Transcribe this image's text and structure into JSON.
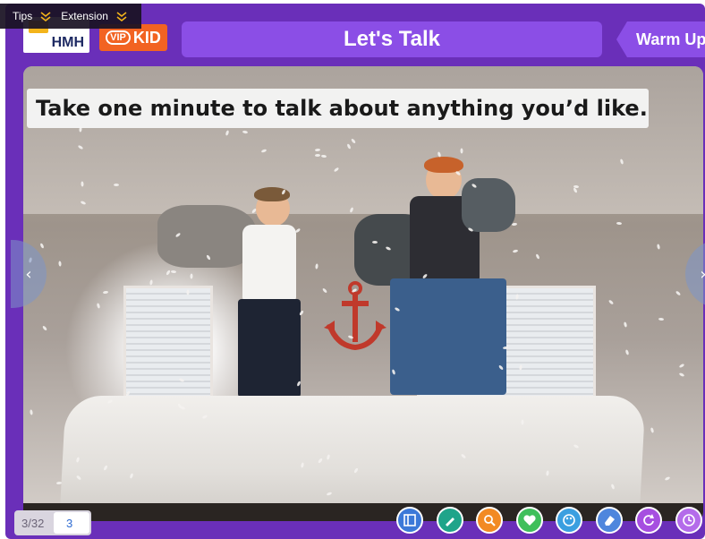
{
  "toolbar_top": {
    "tips_label": "Tips",
    "extension_label": "Extension"
  },
  "brand": {
    "hmh_logo_text": "HMH",
    "vipkid_logo_text": "KID",
    "vipkid_badge": "VIP"
  },
  "header": {
    "title": "Let's Talk",
    "section_tag": "Warm Up"
  },
  "slide": {
    "prompt": "Take one minute to talk about anything you’d like."
  },
  "navigation": {
    "prev_arrow": "‹",
    "next_arrow": "›"
  },
  "pagination": {
    "counter": "3/32",
    "current_page": "3"
  },
  "tools": [
    {
      "name": "layout-tool",
      "color": "#3c79d8"
    },
    {
      "name": "pen-tool",
      "color": "#1fa48a"
    },
    {
      "name": "magnifier-tool",
      "color": "#f28a23"
    },
    {
      "name": "sticker-tool",
      "color": "#3fbf5b"
    },
    {
      "name": "palette-tool",
      "color": "#3b9fe0"
    },
    {
      "name": "eraser-tool",
      "color": "#4f86dd"
    },
    {
      "name": "reset-tool",
      "color": "#a64ee0"
    },
    {
      "name": "timer-tool",
      "color": "#b46bea"
    }
  ],
  "colors": {
    "frame": "#6a2fb9",
    "header_pill": "#8b4ee6",
    "vipkid_orange": "#f26322"
  }
}
